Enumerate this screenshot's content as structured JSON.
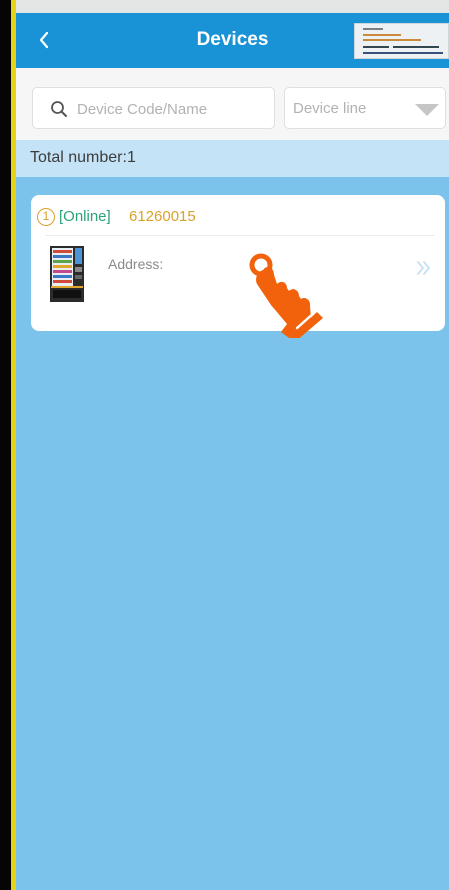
{
  "header": {
    "back_icon": "chevron-left-icon",
    "title": "Devices",
    "screenshot_thumbnail_icon": "screenshot-thumbnail-icon"
  },
  "search": {
    "icon": "search-icon",
    "placeholder": "Device Code/Name",
    "value": ""
  },
  "device_line_select": {
    "label": "Device line",
    "icon": "dropdown-triangle-icon"
  },
  "summary": {
    "total_label": "Total number:1"
  },
  "devices": [
    {
      "index": "1",
      "status": "[Online]",
      "code": "61260015",
      "address_label": "Address:",
      "address_value": "",
      "image_icon": "vending-machine-icon",
      "open_icon": "double-chevron-right-icon"
    }
  ],
  "overlay": {
    "pointer_icon": "tap-hand-icon"
  },
  "colors": {
    "header_bg": "#1a93d6",
    "page_bg": "#7cc3ec",
    "online_status": "#2aa27a",
    "device_code": "#d8a22a",
    "total_bar_bg": "#c5e3f7",
    "hand_orange": "#f2620d"
  }
}
